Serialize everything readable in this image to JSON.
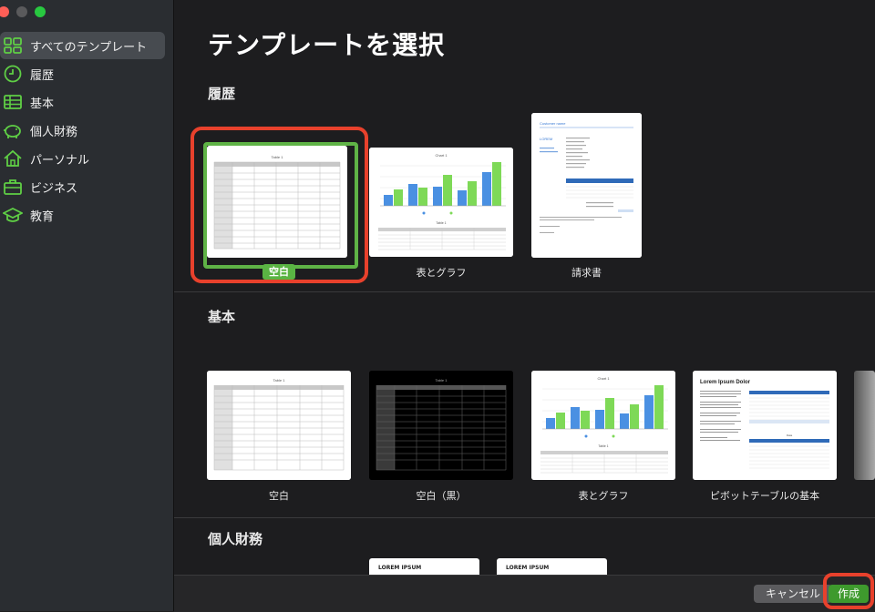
{
  "sidebar": {
    "items": [
      {
        "label": "すべてのテンプレート",
        "icon": "grid-icon",
        "selected": true
      },
      {
        "label": "履歴",
        "icon": "clock-icon"
      },
      {
        "label": "基本",
        "icon": "table-icon"
      },
      {
        "label": "個人財務",
        "icon": "piggy-bank-icon"
      },
      {
        "label": "パーソナル",
        "icon": "house-icon"
      },
      {
        "label": "ビジネス",
        "icon": "briefcase-icon"
      },
      {
        "label": "教育",
        "icon": "graduation-cap-icon"
      }
    ]
  },
  "main": {
    "title": "テンプレートを選択",
    "sections": [
      {
        "heading": "履歴",
        "templates": [
          "空白",
          "表とグラフ",
          "請求書"
        ]
      },
      {
        "heading": "基本",
        "templates": [
          "空白",
          "空白（黒）",
          "表とグラフ",
          "ピボットテーブルの基本"
        ]
      },
      {
        "heading": "個人財務",
        "templates": []
      }
    ]
  },
  "thumbs": {
    "lorem": "LOREM IPSUM",
    "lorem_dolor": "Lorem Ipsum Dolor",
    "invoice_title": "Customer name",
    "invoice_lorem": "LOREM"
  },
  "footer": {
    "cancel": "キャンセル",
    "create": "作成"
  },
  "colors": {
    "accent_green": "#5fb346",
    "highlight_red": "#e8412c",
    "bar_blue": "#4a90e2",
    "bar_green": "#7ed957"
  }
}
